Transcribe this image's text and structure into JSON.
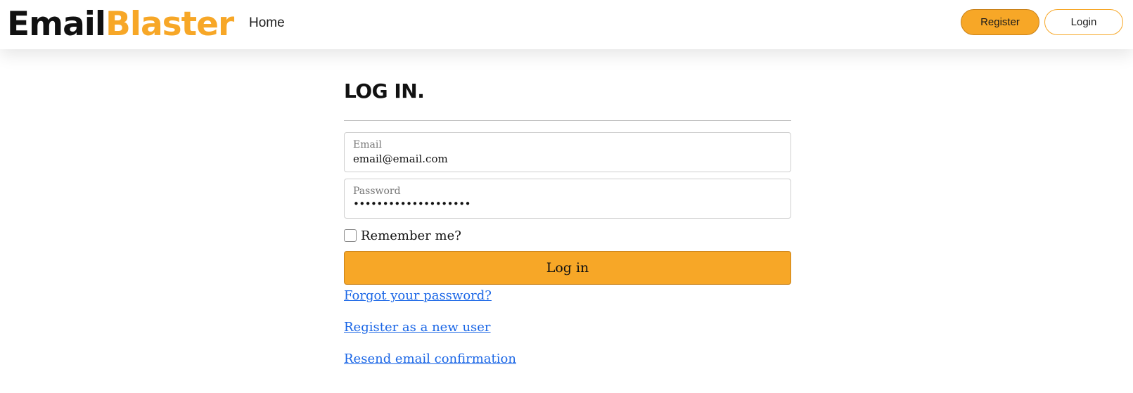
{
  "navbar": {
    "brand_part_1": "Email",
    "brand_part_2": "Blaster",
    "home_label": "Home",
    "register_label": "Register",
    "login_label": "Login"
  },
  "login": {
    "title": "LOG IN.",
    "email": {
      "label": "Email",
      "value": "email@email.com"
    },
    "password": {
      "label": "Password",
      "value": "••••••••••••••••••••"
    },
    "remember_label": "Remember me?",
    "remember_checked": false,
    "submit_label": "Log in",
    "links": {
      "forgot_password": "Forgot your password?",
      "register_new": "Register as a new user",
      "resend_confirmation": "Resend email confirmation"
    }
  },
  "colors": {
    "accent": "#f7a727",
    "link": "#1a66e6",
    "text": "#111111"
  }
}
